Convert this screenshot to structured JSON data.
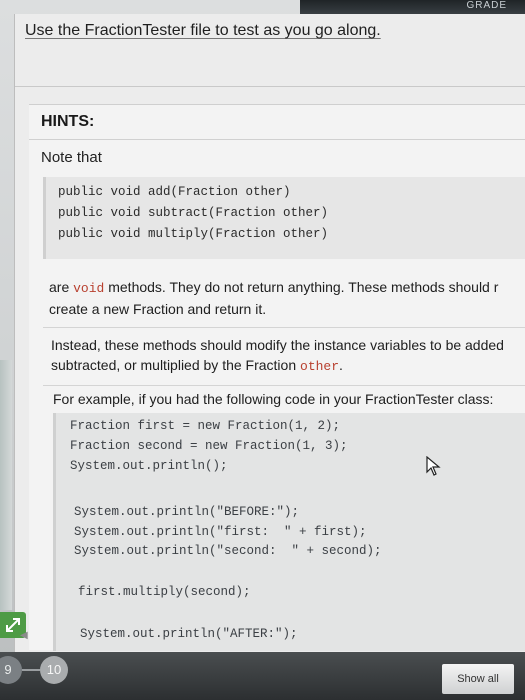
{
  "top_label": "GRADE",
  "intro": "Use the FractionTester file to test as you go along.",
  "hints": {
    "title": "HINTS:",
    "note": "Note that",
    "code_block_1": [
      "public void add(Fraction other)",
      "public void subtract(Fraction other)",
      "public void multiply(Fraction other)"
    ],
    "para1": {
      "pre": "are ",
      "kw": "void",
      "post_line1": " methods. They do not return anything. These methods should r",
      "line2": "create a new Fraction and return it."
    },
    "para2": {
      "line1": "Instead, these methods should modify the instance variables to be added",
      "line2_pre": "subtracted, or multiplied by the Fraction ",
      "line2_kw": "other",
      "line2_post": "."
    },
    "para3": "For example, if you had the following code in your FractionTester class:",
    "code_block_2": [
      "Fraction first = new Fraction(1, 2);",
      "Fraction second = new Fraction(1, 3);",
      "System.out.println();",
      "",
      "System.out.println(\"BEFORE:\");",
      "System.out.println(\"first:  \" + first);",
      "System.out.println(\"second:  \" + second);",
      "",
      "first.multiply(second);",
      "",
      "System.out.println(\"AFTER:\");"
    ]
  },
  "bottom": {
    "page_prev": "9",
    "page_current": "10",
    "show_all": "Show all"
  },
  "colors": {
    "keyword": "#b8402f",
    "expand_button": "#4e9b45"
  }
}
